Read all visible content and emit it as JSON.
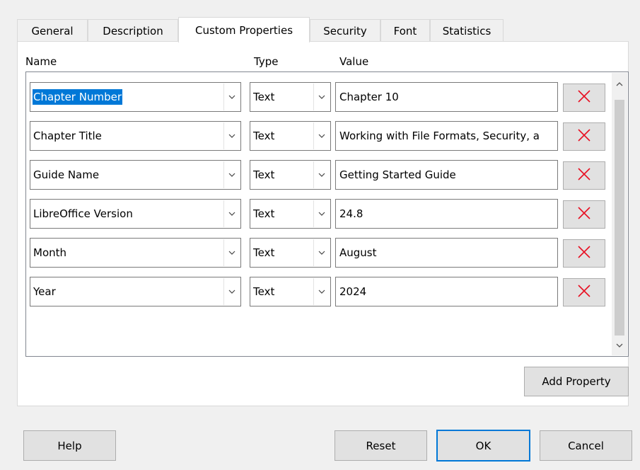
{
  "tabs": [
    {
      "label": "General"
    },
    {
      "label": "Description"
    },
    {
      "label": "Custom Properties"
    },
    {
      "label": "Security"
    },
    {
      "label": "Font"
    },
    {
      "label": "Statistics"
    }
  ],
  "active_tab": "Custom Properties",
  "columns": {
    "name": "Name",
    "type": "Type",
    "value": "Value"
  },
  "properties": [
    {
      "name": "Chapter Number",
      "type": "Text",
      "value": "Chapter 10"
    },
    {
      "name": "Chapter Title",
      "type": "Text",
      "value": "Working with File Formats, Security, a"
    },
    {
      "name": "Guide Name",
      "type": "Text",
      "value": "Getting Started Guide"
    },
    {
      "name": "LibreOffice Version",
      "type": "Text",
      "value": "24.8"
    },
    {
      "name": "Month",
      "type": "Text",
      "value": "August"
    },
    {
      "name": "Year",
      "type": "Text",
      "value": "2024"
    }
  ],
  "buttons": {
    "add_property": "Add Property",
    "help": "Help",
    "reset": "Reset",
    "ok": "OK",
    "cancel": "Cancel"
  },
  "icons": {
    "delete": "close-icon",
    "dropdown": "chevron-down-icon"
  },
  "colors": {
    "delete_icon": "#e81123",
    "selection": "#0078d7",
    "default_button_border": "#0078d7"
  }
}
